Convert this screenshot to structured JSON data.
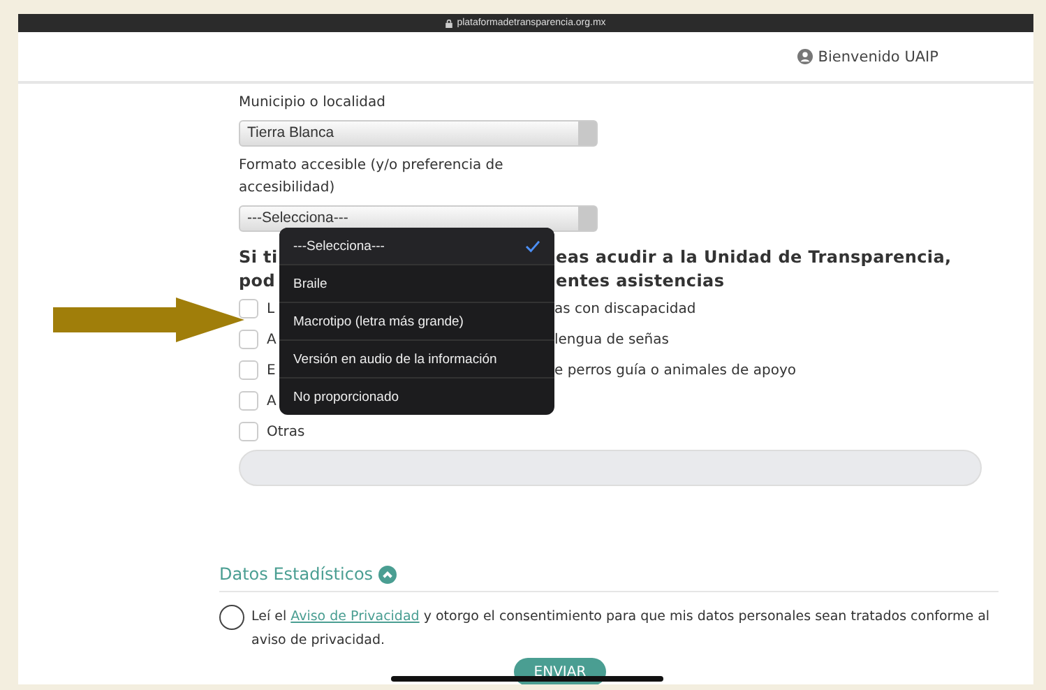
{
  "browser": {
    "url": "plataformadetransparencia.org.mx"
  },
  "header": {
    "greeting": "Bienvenido UAIP"
  },
  "form": {
    "municipio": {
      "label": "Municipio o localidad",
      "value": "Tierra Blanca"
    },
    "formato": {
      "label": "Formato accesible (y/o preferencia de accesibilidad)",
      "value": "---Selecciona---"
    },
    "question": [
      {
        "left": "Si ti",
        "right": "eas acudir a la Unidad de Transparencia,"
      },
      {
        "left": "pod",
        "right": "entes asistencias"
      }
    ],
    "options": [
      {
        "left": "L",
        "right": "as con discapacidad",
        "checked": false
      },
      {
        "left": "A",
        "right": "lengua de señas",
        "checked": false
      },
      {
        "left": "E",
        "right": "e perros guía o animales de apoyo",
        "checked": false
      },
      {
        "left": "A",
        "checked": false
      },
      {
        "left": "Otras",
        "checked": false
      }
    ]
  },
  "dropdown_menu": [
    {
      "label": "---Selecciona---",
      "selected": true
    },
    {
      "label": "Braile",
      "selected": false
    },
    {
      "label": "Macrotipo (letra más grande)",
      "selected": false
    },
    {
      "label": "Versión en audio de la información",
      "selected": false
    },
    {
      "label": "No proporcionado",
      "selected": false
    }
  ],
  "section": {
    "title": "Datos Estadísticos",
    "expanded": true
  },
  "privacy": {
    "checked": false,
    "before": "Leí el ",
    "link": "Aviso de Privacidad",
    "after": " y otorgo el consentimiento para que mis datos personales sean tratados conforme al aviso de privacidad."
  },
  "submit": {
    "label": "ENVIAR"
  }
}
